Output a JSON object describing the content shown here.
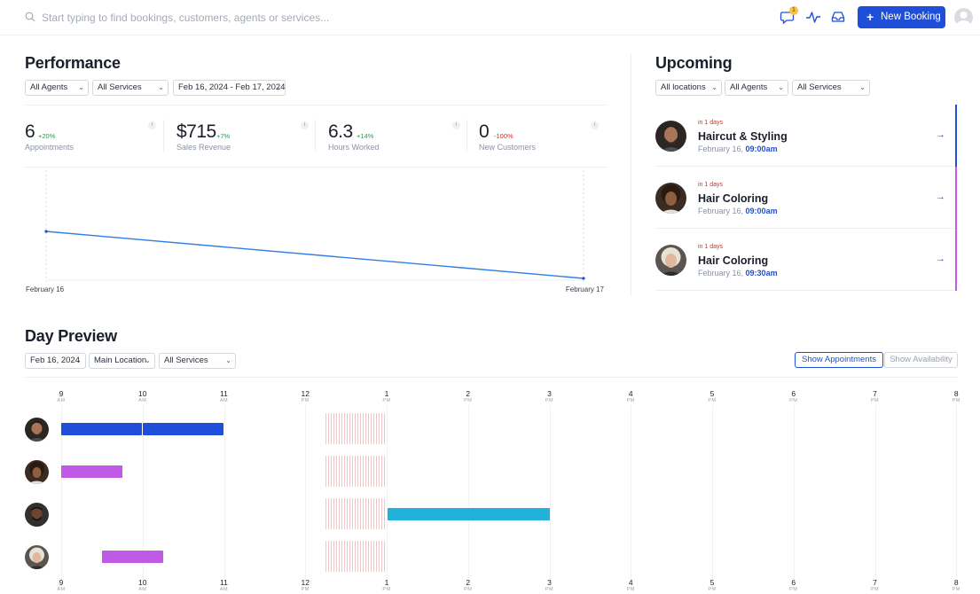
{
  "search": {
    "placeholder": "Start typing to find bookings, customers, agents or services..."
  },
  "topbar": {
    "notification_count": "1",
    "new_booking_label": "New Booking"
  },
  "performance": {
    "title": "Performance",
    "filters": {
      "agents": "All Agents",
      "services": "All Services",
      "date_range": "Feb 16, 2024 - Feb 17, 2024"
    },
    "kpis": [
      {
        "value": "6",
        "delta": "+20%",
        "label": "Appointments"
      },
      {
        "value": "$715",
        "delta": "+7%",
        "label": "Sales Revenue"
      },
      {
        "value": "6.3",
        "delta": "+14%",
        "label": "Hours Worked"
      },
      {
        "value": "0",
        "delta": "-100%",
        "label": "New Customers"
      }
    ],
    "info_label": "i"
  },
  "chart_data": {
    "type": "line",
    "x": [
      "February 16",
      "February 17"
    ],
    "series": [
      {
        "values": [
          6,
          0
        ]
      }
    ],
    "title": "",
    "xlabel": "",
    "ylabel": "",
    "grid": false
  },
  "upcoming": {
    "title": "Upcoming",
    "filters": {
      "locations": "All locations",
      "agents": "All Agents",
      "services": "All Services"
    },
    "items": [
      {
        "when": "in 1 days",
        "service": "Haircut & Styling",
        "date": "February 16,",
        "time": "09:00am",
        "color": "#1f4fd8"
      },
      {
        "when": "in 1 days",
        "service": "Hair Coloring",
        "date": "February 16,",
        "time": "09:00am",
        "color": "#c05ae6"
      },
      {
        "when": "in 1 days",
        "service": "Hair Coloring",
        "date": "February 16,",
        "time": "09:30am",
        "color": "#c05ae6"
      }
    ]
  },
  "day_preview": {
    "title": "Day Preview",
    "filters": {
      "date": "Feb 16, 2024",
      "location": "Main Location",
      "services": "All Services"
    },
    "toggles": {
      "show_appointments": "Show Appointments",
      "show_availability": "Show Availability"
    },
    "hours": [
      {
        "n": "9",
        "m": "AM"
      },
      {
        "n": "10",
        "m": "AM"
      },
      {
        "n": "11",
        "m": "AM"
      },
      {
        "n": "12",
        "m": "PM"
      },
      {
        "n": "1",
        "m": "PM"
      },
      {
        "n": "2",
        "m": "PM"
      },
      {
        "n": "3",
        "m": "PM"
      },
      {
        "n": "4",
        "m": "PM"
      },
      {
        "n": "5",
        "m": "PM"
      },
      {
        "n": "6",
        "m": "PM"
      },
      {
        "n": "7",
        "m": "PM"
      },
      {
        "n": "8",
        "m": "PM"
      }
    ],
    "colors": {
      "blue": "#1f4fd8",
      "purple": "#c05ae6",
      "cyan": "#22b0dc",
      "blocked": "#f4b9bd"
    }
  }
}
